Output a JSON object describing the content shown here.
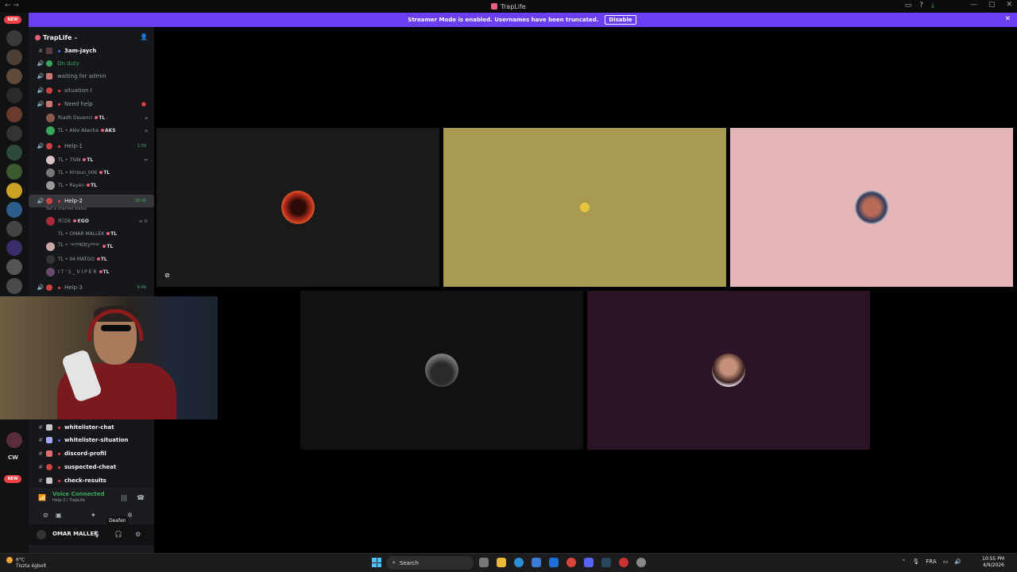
{
  "window": {
    "title": "TrapLife",
    "nav": "← →"
  },
  "banner": {
    "text": "Streamer Mode is enabled. Usernames have been truncated.",
    "button": "Disable"
  },
  "rail": {
    "new_badge_top": "NEW",
    "new_badge_bottom": "NEW",
    "cw_label": "CW"
  },
  "server": {
    "name": "TrapLife"
  },
  "channels": [
    {
      "label": "3am-jaych",
      "type": "text"
    },
    {
      "label": "On duty",
      "type": "voice"
    },
    {
      "label": "waiting for admin",
      "type": "voice"
    },
    {
      "label": "situation I",
      "type": "voice"
    },
    {
      "label": "Need help",
      "type": "voice"
    },
    {
      "label": "Help-1",
      "type": "voice",
      "timer": "1:58"
    },
    {
      "label": "Help-2",
      "type": "voice",
      "timer": "38:46"
    },
    {
      "label": "Help-3",
      "type": "voice",
      "timer": "8:48"
    },
    {
      "label": "whitelister-chat",
      "type": "text"
    },
    {
      "label": "whitelister-situation",
      "type": "text"
    },
    {
      "label": "discord-profil",
      "type": "text"
    },
    {
      "label": "suspected-cheat",
      "type": "text"
    },
    {
      "label": "check-results",
      "type": "text"
    }
  ],
  "help2_status": "Set a channel status",
  "users": {
    "need_help": [
      {
        "name": "Riadh Davenci",
        "tag": "TL"
      },
      {
        "name": "TL • Alex Akecha",
        "tag": "AKS"
      }
    ],
    "help1": [
      {
        "name": "TL • 7SIN",
        "tag": "TL"
      },
      {
        "name": "TL • H!roun_006",
        "tag": "TL"
      },
      {
        "name": "TL • Rayen",
        "tag": "TL"
      }
    ],
    "help2": [
      {
        "name": "ЯΞDE",
        "tag": "ЄGO"
      },
      {
        "name": "TL • OMAR MALLEK",
        "tag": "TL"
      },
      {
        "name": "TL • ༺*Kitty*༻",
        "tag": "TL"
      },
      {
        "name": "TL • 04 MATOO",
        "tag": "TL"
      },
      {
        "name": "I T ' S _ V I P E R",
        "tag": "TL"
      }
    ]
  },
  "voice_panel": {
    "status": "Voice Connected",
    "channel": "Help-2 / TrapLife",
    "username": "OMAR MALLEK",
    "tooltip": "Deafen"
  },
  "taskbar": {
    "weather_temp": "6°C",
    "weather_text": "Tiszta égbolt",
    "search": "Search",
    "lang": "FRA",
    "time": "10:55 PM",
    "date": "4/9/2026"
  }
}
